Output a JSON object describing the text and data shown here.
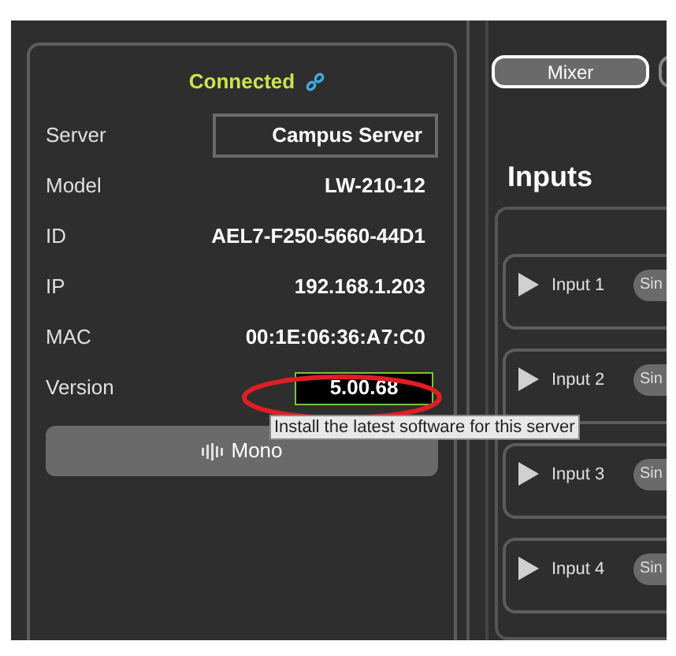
{
  "status": {
    "text": "Connected",
    "connected": true
  },
  "fields": [
    {
      "kind": "box",
      "label": "Server",
      "value": "Campus Server"
    },
    {
      "kind": "plain",
      "label": "Model",
      "value": "LW-210-12"
    },
    {
      "kind": "plain",
      "label": "ID",
      "value": "AEL7-F250-5660-44D1"
    },
    {
      "kind": "plain",
      "label": "IP",
      "value": "192.168.1.203"
    },
    {
      "kind": "plain",
      "label": "MAC",
      "value": "00:1E:06:36:A7:C0"
    },
    {
      "kind": "version",
      "label": "Version",
      "value": "5.00.68"
    }
  ],
  "tooltip": "Install the latest software for this server",
  "mode_button": {
    "label": "Mono"
  },
  "tabs": [
    {
      "label": "Mixer",
      "selected": true
    }
  ],
  "section_title": "Inputs",
  "inputs": [
    {
      "label": "Input 1",
      "chip": "Sin"
    },
    {
      "label": "Input 2",
      "chip": "Sin"
    },
    {
      "label": "Input 3",
      "chip": "Sin"
    },
    {
      "label": "Input 4",
      "chip": "Sin"
    }
  ]
}
